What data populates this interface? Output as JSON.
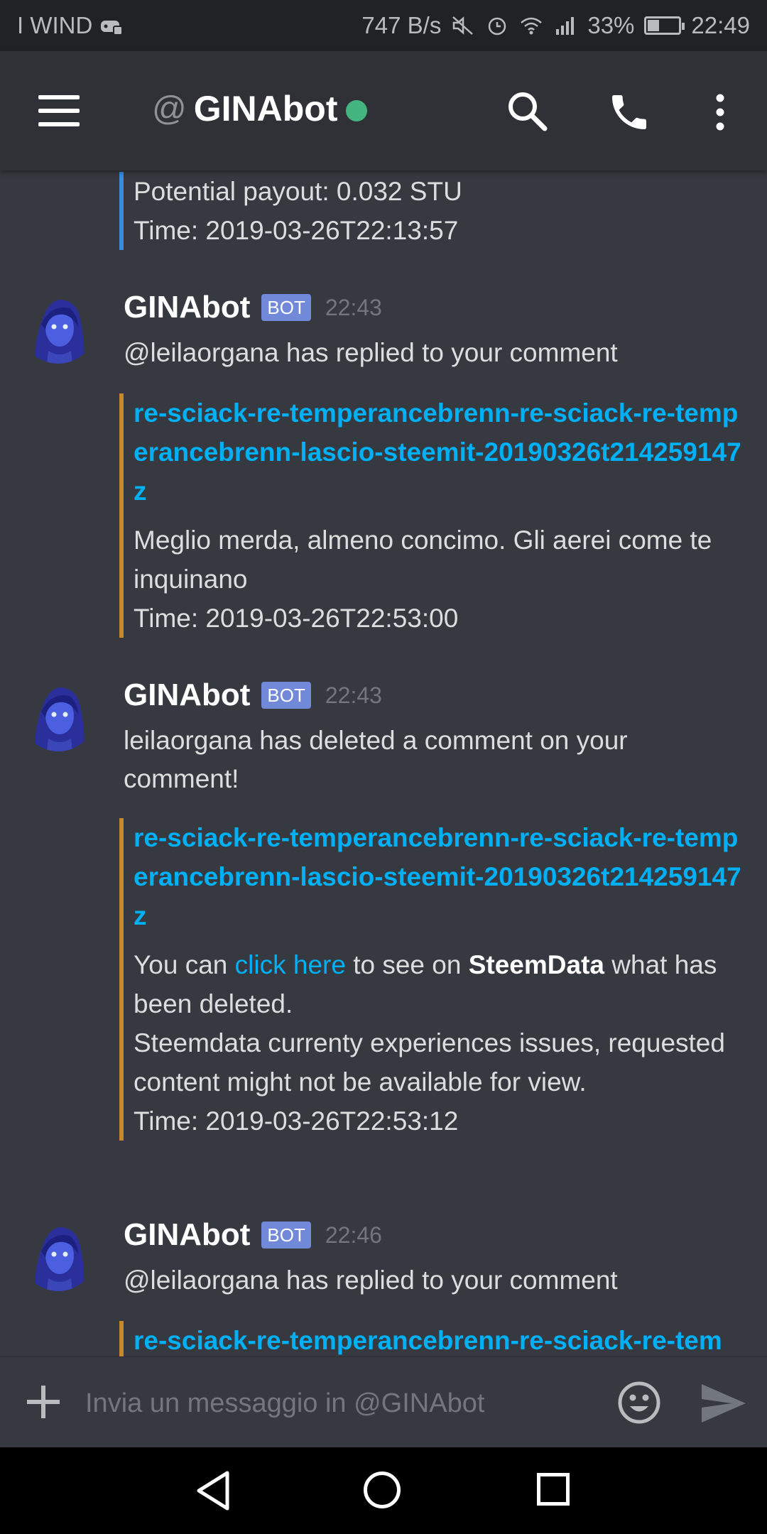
{
  "status_bar": {
    "carrier": "I WIND",
    "speed": "747 B/s",
    "battery": "33%",
    "battery_level": 0.33,
    "time": "22:49"
  },
  "header": {
    "at": "@",
    "channel": "GINAbot",
    "icons": [
      "menu-icon",
      "search-icon",
      "phone-icon",
      "more-vert-icon"
    ],
    "online_color": "#43b581"
  },
  "messages": [
    {
      "embed": {
        "lines": [
          "Potential payout: 0.032 STU",
          "Time: 2019-03-26T22:13:57"
        ],
        "accent": "#3a8ce0"
      }
    },
    {
      "author": "GINAbot",
      "tag": "BOT",
      "time": "22:43",
      "text": "@leilaorgana has replied to your comment",
      "embed": {
        "link": "re-sciack-re-temperancebrenn-re-sciack-re-temperancebrenn-lascio-steemit-20190326t214259147z",
        "desc": "Meglio merda, almeno concimo. Gli aerei come te inquinano",
        "time": "Time: 2019-03-26T22:53:00",
        "accent": "#c7892b"
      }
    },
    {
      "author": "GINAbot",
      "tag": "BOT",
      "time": "22:43",
      "text": "leilaorgana has deleted a comment on your comment!",
      "embed": {
        "link": "re-sciack-re-temperancebrenn-re-sciack-re-temperancebrenn-lascio-steemit-20190326t214259147z",
        "desc_pre": "You can ",
        "desc_link": "click here",
        "desc_mid": " to see on ",
        "desc_bold": "SteemData",
        "desc_post": " what has been deleted.",
        "desc2": "Steemdata currenty experiences issues, requested content might not be available for view.",
        "time": "Time: 2019-03-26T22:53:12",
        "accent": "#c7892b"
      }
    },
    {
      "author": "GINAbot",
      "tag": "BOT",
      "time": "22:46",
      "text": "@leilaorgana has replied to your comment",
      "embed": {
        "link": "re-sciack-re-temperancebrenn-re-sciack-re-tem",
        "accent": "#c7892b"
      }
    }
  ],
  "input": {
    "placeholder": "Invia un messaggio in @GINAbot"
  },
  "navbar": {
    "icons": [
      "back-icon",
      "home-icon",
      "recents-icon"
    ]
  }
}
